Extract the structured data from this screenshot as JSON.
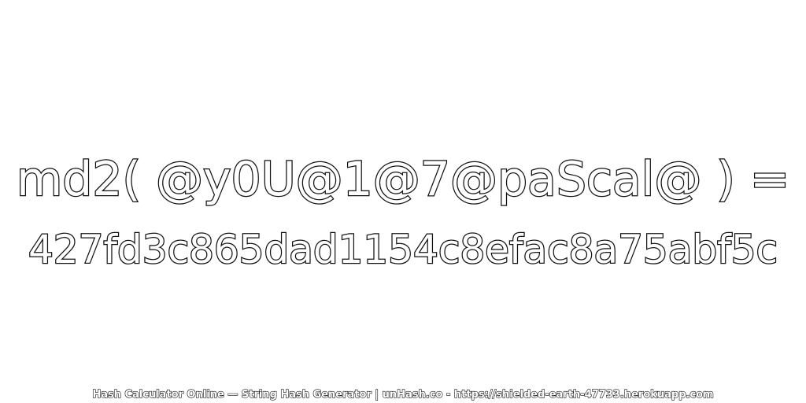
{
  "expression": "md2( @y0U@1@7@paScal@ ) =",
  "hash_value": "427fd3c865dad1154c8efac8a75abf5c",
  "footer": "Hash Calculator Online — String Hash Generator | unHash.co - https://shielded-earth-47733.herokuapp.com",
  "colors": {
    "background": "#ffffff",
    "text_fill": "#ffffff",
    "text_outline": "#111111"
  }
}
